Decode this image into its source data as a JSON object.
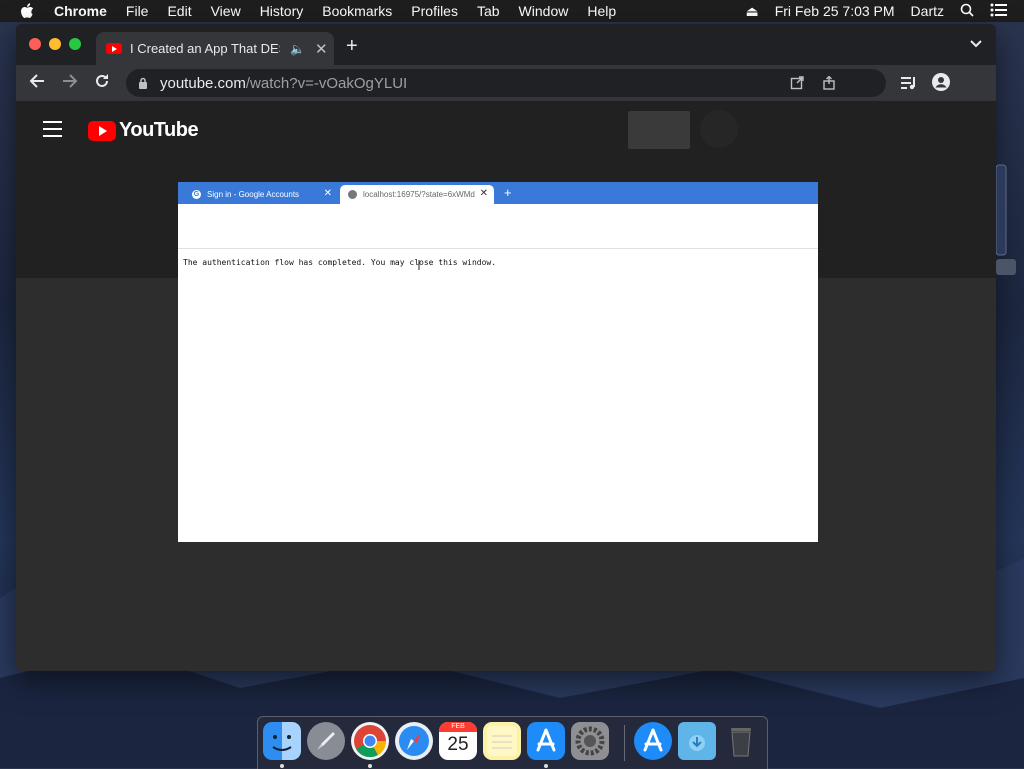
{
  "menubar": {
    "app": "Chrome",
    "items": [
      "File",
      "Edit",
      "View",
      "History",
      "Bookmarks",
      "Profiles",
      "Tab",
      "Window",
      "Help"
    ],
    "datetime": "Fri Feb 25  7:03 PM",
    "user": "Dartz"
  },
  "browser": {
    "tab_title": "I Created an App That DES",
    "url_host": "youtube.com",
    "url_path": "/watch?v=-vOakOgYLUI"
  },
  "youtube": {
    "logo_text": "YouTube"
  },
  "video": {
    "tab1_title": "Sign in - Google Accounts",
    "tab2_title": "localhost:16975/?state=6xWMd",
    "message": "The authentication flow has completed. You may close this window."
  },
  "dock": {
    "calendar_month": "FEB",
    "calendar_day": "25"
  },
  "colors": {
    "youtube_red": "#ff0000",
    "chrome_dark": "#202124",
    "video_tabbar": "#3a79d8"
  }
}
